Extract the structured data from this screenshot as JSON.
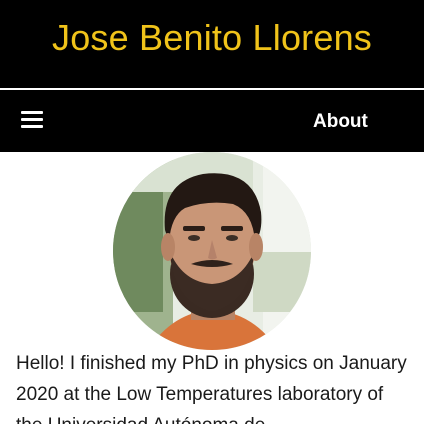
{
  "theme": {
    "title_color": "#f0c31a",
    "header_bg": "#000000",
    "nav_text": "#ffffff"
  },
  "header": {
    "title": "Jose Benito Llorens"
  },
  "nav": {
    "menu_icon": "hamburger-menu-icon",
    "about_label": "About"
  },
  "profile": {
    "photo_alt": "Jose Benito Llorens",
    "bio": "Hello! I finished my PhD in physics on January 2020 at the Low Temperatures laboratory of the Universidad Autónoma de"
  }
}
